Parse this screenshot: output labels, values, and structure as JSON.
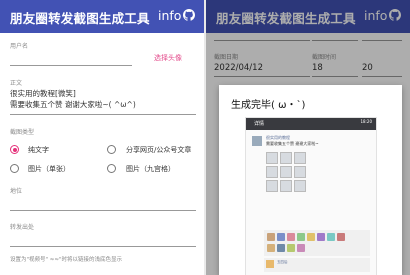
{
  "app": {
    "title": "朋友圈转发截图生成工具",
    "info_label": "info",
    "github_icon": "github-icon",
    "accent": "#4252b4",
    "pink": "#e5317a"
  },
  "form": {
    "username_label": "用户名",
    "pick_avatar": "选择头像",
    "content_label": "正文",
    "content_line1": "很实用的教程[微笑]",
    "content_line2": "需要收集五个赞 谢谢大家啦~(   ^ω^)",
    "type_label": "截图类型",
    "types": [
      {
        "label": "纯文字",
        "checked": true
      },
      {
        "label": "分享网页/公众号文章",
        "checked": false
      },
      {
        "label": "图片（单张）",
        "checked": false
      },
      {
        "label": "图片（九宫格）",
        "checked": false
      }
    ],
    "location_label": "地位",
    "source_label": "转发出处",
    "hint": "设置为\"视频号\" ≈≈\"时将以链接的浅底色显示"
  },
  "right": {
    "date_label": "截图日期",
    "time_label": "截图时间",
    "date_value": "2022/04/12",
    "hour_value": "18",
    "minute_value": "20",
    "dialog_title": "生成完毕( ω・`)",
    "shot_header": "详情",
    "shot_time": "18:20",
    "shot_name": "很实用的教程",
    "shot_line1": "需要收集五个赞 谢谢大家啦~",
    "shot_comment": "五四后"
  }
}
